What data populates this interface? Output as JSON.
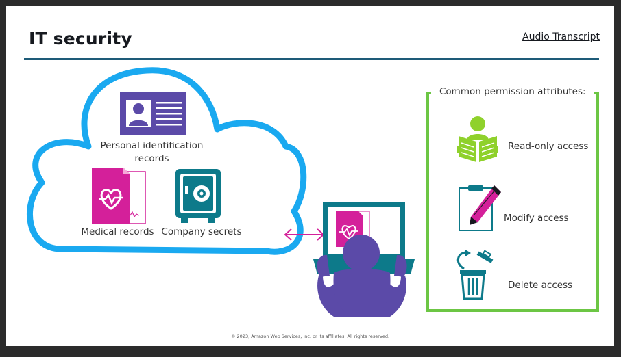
{
  "slide": {
    "title": "IT security",
    "audio_transcript_link": "Audio Transcript",
    "footer": "© 2023, Amazon Web Services, Inc. or its affiliates. All rights reserved."
  },
  "cloud": {
    "items": [
      {
        "label_line1": "Personal identification",
        "label_line2": "records",
        "icon": "id-card-icon"
      },
      {
        "label": "Medical records",
        "icon": "medical-file-icon"
      },
      {
        "label": "Company secrets",
        "icon": "safe-icon"
      }
    ]
  },
  "permissions": {
    "title": "Common permission attributes:",
    "items": [
      {
        "label": "Read-only access",
        "icon": "reading-person-icon"
      },
      {
        "label": "Modify access",
        "icon": "clipboard-pencil-icon"
      },
      {
        "label": "Delete access",
        "icon": "trash-can-icon"
      }
    ]
  },
  "colors": {
    "cloud": "#1aa9f0",
    "purple": "#5b4aa8",
    "magenta": "#d4209a",
    "teal": "#0d7a8a",
    "green": "#6cc644",
    "lime": "#8fd12c",
    "title_rule": "#1e5b78"
  }
}
